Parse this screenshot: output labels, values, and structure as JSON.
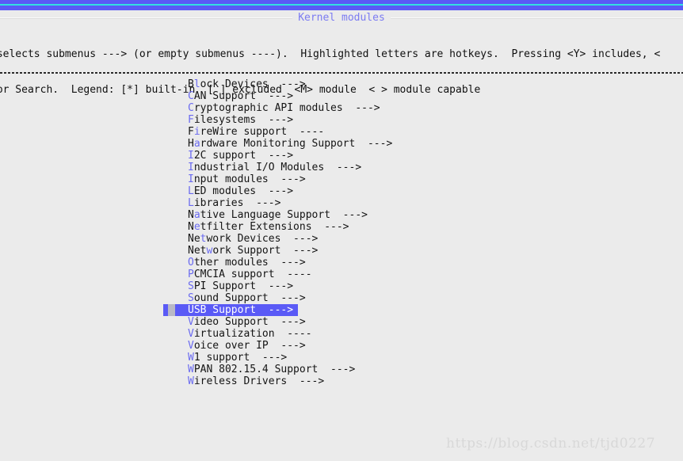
{
  "window": {
    "title": "Kernel modules",
    "accent_blue": "#5a5af6",
    "accent_cyan": "#33e0e0",
    "background": "#ebebeb",
    "hotkey_color": "#6a6af0",
    "selection_bg": "#5a5af6",
    "selection_fg": "#ffffff"
  },
  "help": {
    "line1": " selects submenus ---> (or empty submenus ----).  Highlighted letters are hotkeys.  Pressing <Y> includes, <",
    "line2": "for Search.  Legend: [*] built-in  [ ] excluded  <M> module  < > module capable"
  },
  "menu": {
    "items": [
      {
        "pre": "B",
        "hot": "l",
        "post": "ock Devices",
        "arrow": "--->",
        "selected": false
      },
      {
        "pre": "",
        "hot": "C",
        "post": "AN Support",
        "arrow": "--->",
        "selected": false
      },
      {
        "pre": "",
        "hot": "C",
        "post": "ryptographic API modules",
        "arrow": "--->",
        "selected": false
      },
      {
        "pre": "",
        "hot": "F",
        "post": "ilesystems",
        "arrow": "--->",
        "selected": false
      },
      {
        "pre": "F",
        "hot": "i",
        "post": "reWire support",
        "arrow": "----",
        "selected": false
      },
      {
        "pre": "H",
        "hot": "a",
        "post": "rdware Monitoring Support",
        "arrow": "--->",
        "selected": false
      },
      {
        "pre": "",
        "hot": "I",
        "post": "2C support",
        "arrow": "--->",
        "selected": false
      },
      {
        "pre": "",
        "hot": "I",
        "post": "ndustrial I/O Modules",
        "arrow": "--->",
        "selected": false
      },
      {
        "pre": "",
        "hot": "I",
        "post": "nput modules",
        "arrow": "--->",
        "selected": false
      },
      {
        "pre": "",
        "hot": "L",
        "post": "ED modules",
        "arrow": "--->",
        "selected": false
      },
      {
        "pre": "",
        "hot": "L",
        "post": "ibraries",
        "arrow": "--->",
        "selected": false
      },
      {
        "pre": "N",
        "hot": "a",
        "post": "tive Language Support",
        "arrow": "--->",
        "selected": false
      },
      {
        "pre": "N",
        "hot": "e",
        "post": "tfilter Extensions",
        "arrow": "--->",
        "selected": false
      },
      {
        "pre": "Ne",
        "hot": "t",
        "post": "work Devices",
        "arrow": "--->",
        "selected": false
      },
      {
        "pre": "Net",
        "hot": "w",
        "post": "ork Support",
        "arrow": "--->",
        "selected": false
      },
      {
        "pre": "",
        "hot": "O",
        "post": "ther modules",
        "arrow": "--->",
        "selected": false
      },
      {
        "pre": "",
        "hot": "P",
        "post": "CMCIA support",
        "arrow": "----",
        "selected": false
      },
      {
        "pre": "",
        "hot": "S",
        "post": "PI Support",
        "arrow": "--->",
        "selected": false
      },
      {
        "pre": "",
        "hot": "S",
        "post": "ound Support",
        "arrow": "--->",
        "selected": false
      },
      {
        "pre": "",
        "hot": "U",
        "post": "SB Support",
        "arrow": "--->",
        "selected": true
      },
      {
        "pre": "",
        "hot": "V",
        "post": "ideo Support",
        "arrow": "--->",
        "selected": false
      },
      {
        "pre": "",
        "hot": "V",
        "post": "irtualization",
        "arrow": "----",
        "selected": false
      },
      {
        "pre": "",
        "hot": "V",
        "post": "oice over IP",
        "arrow": "--->",
        "selected": false
      },
      {
        "pre": "",
        "hot": "W",
        "post": "1 support",
        "arrow": "--->",
        "selected": false
      },
      {
        "pre": "",
        "hot": "W",
        "post": "PAN 802.15.4 Support",
        "arrow": "--->",
        "selected": false
      },
      {
        "pre": "",
        "hot": "W",
        "post": "ireless Drivers",
        "arrow": "--->",
        "selected": false
      }
    ]
  },
  "watermark": {
    "text": "https://blog.csdn.net/tjd0227"
  }
}
